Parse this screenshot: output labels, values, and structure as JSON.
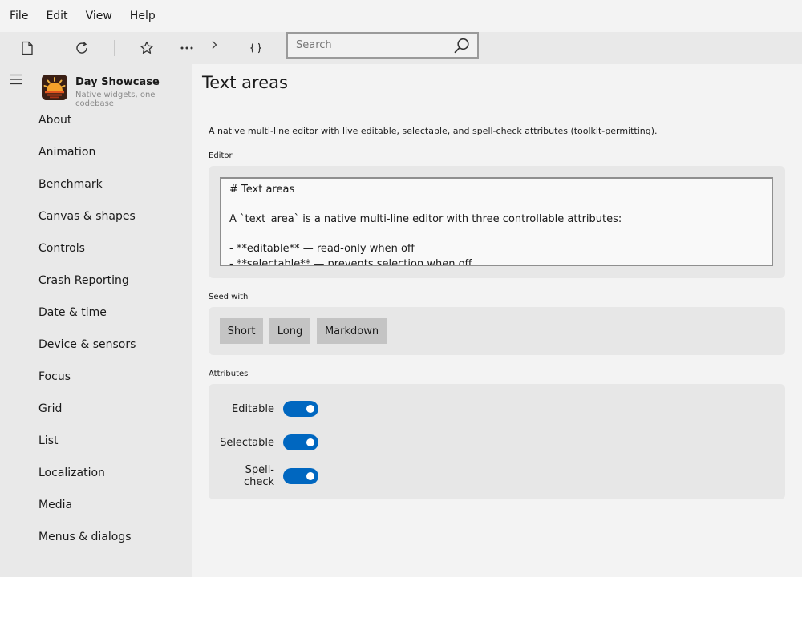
{
  "menubar": {
    "items": [
      "File",
      "Edit",
      "View",
      "Help"
    ]
  },
  "toolbar": {
    "search_placeholder": "Search",
    "icons": [
      "new-document-icon",
      "refresh-icon",
      "star-icon",
      "more-icon",
      "chevron-right-icon",
      "braces-icon",
      "search-icon"
    ]
  },
  "sidebar": {
    "app_name": "Day Showcase",
    "app_tagline": "Native widgets, one codebase",
    "items": [
      "About",
      "Animation",
      "Benchmark",
      "Canvas & shapes",
      "Controls",
      "Crash Reporting",
      "Date & time",
      "Device & sensors",
      "Focus",
      "Grid",
      "List",
      "Localization",
      "Media",
      "Menus & dialogs"
    ]
  },
  "main": {
    "title": "Text areas",
    "description": "A native multi-line editor with live editable, selectable, and spell-check attributes (toolkit-permitting).",
    "editor_label": "Editor",
    "editor_lines": [
      "# Text areas",
      "",
      "A `text_area` is a native multi-line editor with three controllable attributes:",
      "",
      "- **editable** — read-only when off",
      "- **selectable** — prevents selection when off"
    ],
    "seed_label": "Seed with",
    "seed_buttons": [
      "Short",
      "Long",
      "Markdown"
    ],
    "attributes_label": "Attributes",
    "attributes": [
      {
        "label": "Editable",
        "on": true
      },
      {
        "label": "Selectable",
        "on": true
      },
      {
        "label": "Spell-check",
        "on": true
      }
    ]
  },
  "colors": {
    "accent": "#0067c0",
    "sidebar_bg": "#e9e9e9",
    "content_bg": "#f3f3f3",
    "card_bg": "#e7e7e7",
    "button_bg": "#c4c4c4"
  }
}
